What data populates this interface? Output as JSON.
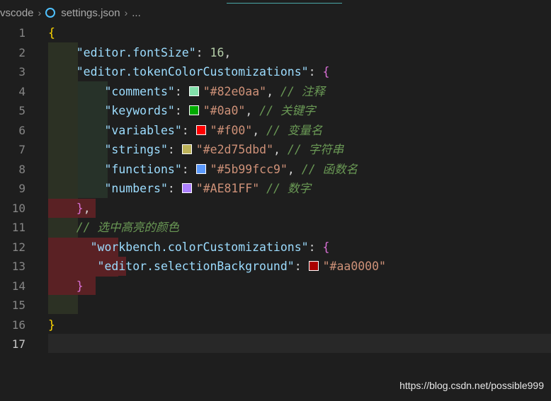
{
  "breadcrumb": {
    "folder": "vscode",
    "file": "settings.json",
    "more": "..."
  },
  "editor": {
    "line_numbers": [
      "1",
      "2",
      "3",
      "4",
      "5",
      "6",
      "7",
      "8",
      "9",
      "10",
      "11",
      "12",
      "13",
      "14",
      "15",
      "16",
      "17"
    ],
    "active_line": "17",
    "font_size_key": "\"editor.fontSize\"",
    "font_size_value": "16",
    "token_key": "\"editor.tokenColorCustomizations\"",
    "token_items": [
      {
        "key": "\"comments\"",
        "value": "\"#82e0aa\"",
        "comment": "// 注释",
        "color": "#82e0aa"
      },
      {
        "key": "\"keywords\"",
        "value": "\"#0a0\"",
        "comment": "// 关键字",
        "color": "#00aa00"
      },
      {
        "key": "\"variables\"",
        "value": "\"#f00\"",
        "comment": "// 变量名",
        "color": "#ff0000"
      },
      {
        "key": "\"strings\"",
        "value": "\"#e2d75dbd\"",
        "comment": "// 字符串",
        "color": "#bdb35a"
      },
      {
        "key": "\"functions\"",
        "value": "\"#5b99fcc9\"",
        "comment": "// 函数名",
        "color": "#5b99fc"
      },
      {
        "key": "\"numbers\"",
        "value": "\"#AE81FF\"",
        "comment": "// 数字",
        "color": "#ae81ff"
      }
    ],
    "selection_comment": "// 选中高亮的颜色",
    "workbench_key": "\"workbench.colorCustomizations\"",
    "selection_key": "\"editor.selectionBackground\"",
    "selection_value": "\"#aa0000\"",
    "selection_color": "#aa0000"
  },
  "watermark": "https://blog.csdn.net/possible999",
  "colors": {
    "background": "#1e1e1e",
    "indent_highlight": "#2c3124",
    "error_highlight": "#5a2124",
    "bracket_gold": "#ffd700",
    "bracket_violet": "#da70d6",
    "key_blue": "#9cdcfe",
    "string_orange": "#ce9178",
    "number_green": "#b5cea8",
    "comment_green": "#6a9955"
  }
}
